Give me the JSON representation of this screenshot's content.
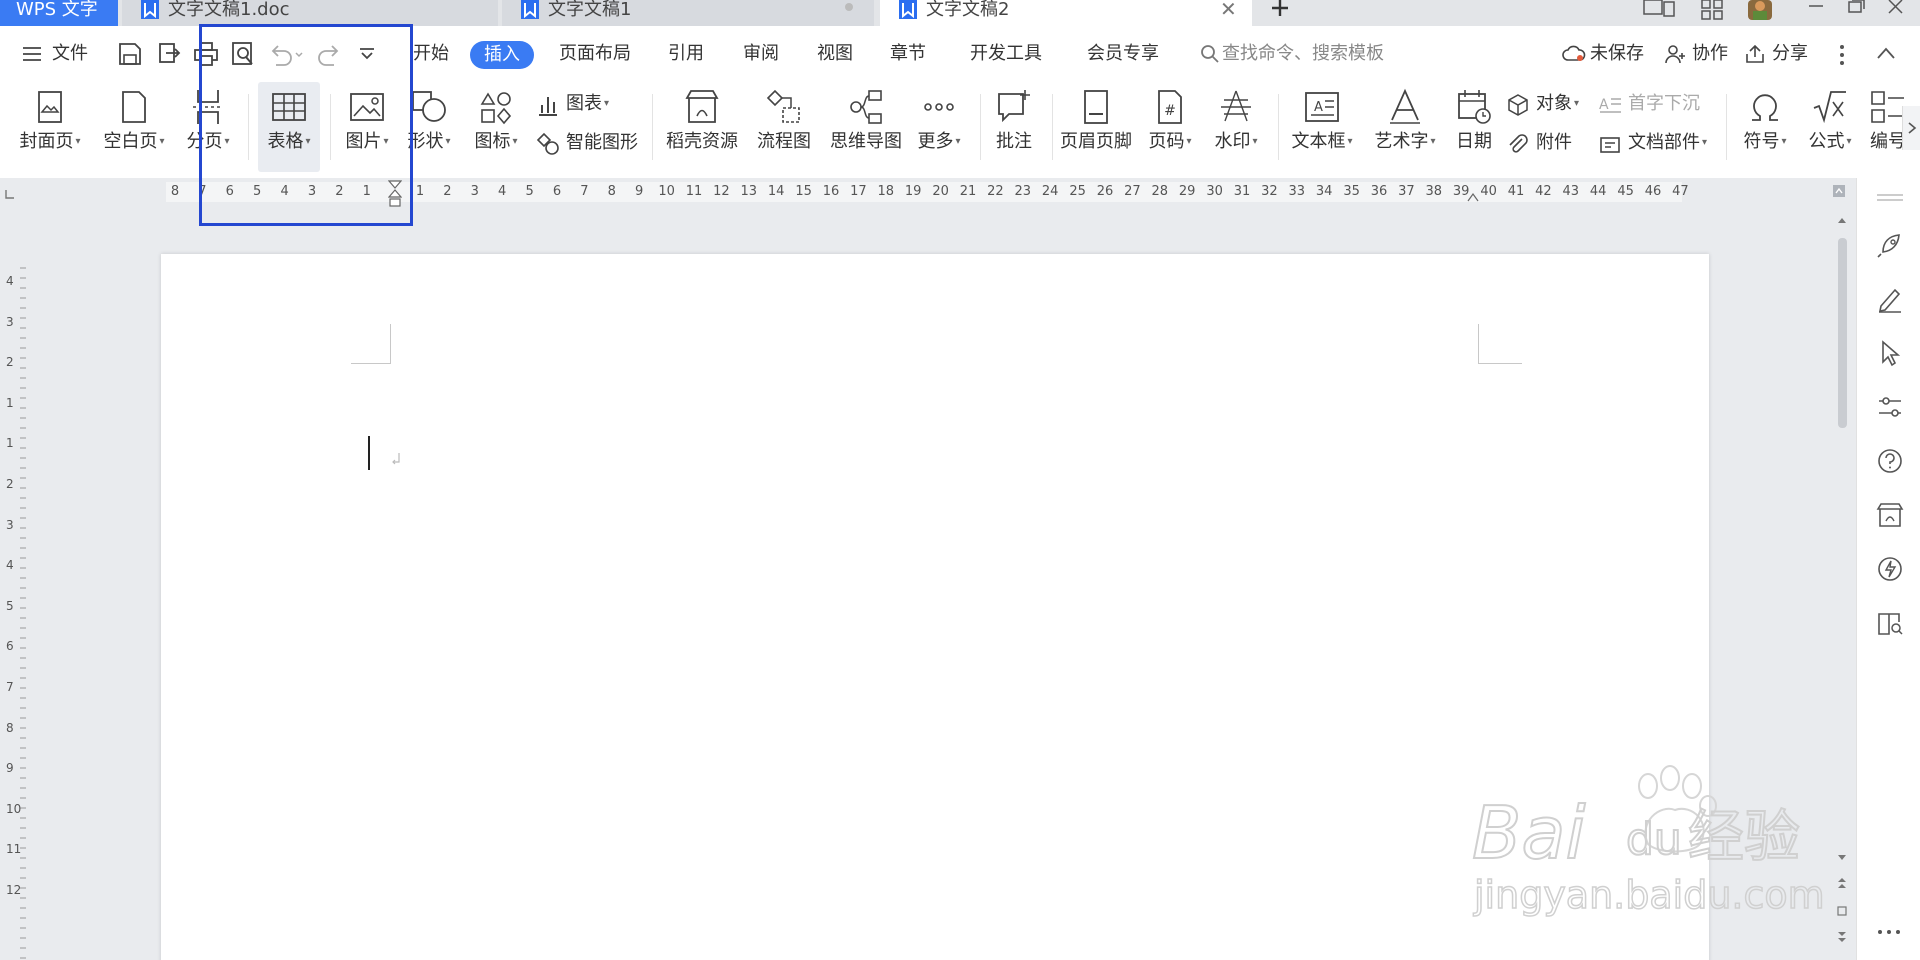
{
  "window": {
    "app_tab": "WPS 文字",
    "tabs": [
      {
        "name": "文字文稿1.doc",
        "active": false
      },
      {
        "name": "文字文稿1",
        "active": false
      },
      {
        "name": "文字文稿2",
        "active": true
      }
    ]
  },
  "menu": {
    "file": "文件",
    "tabs": [
      "开始",
      "插入",
      "页面布局",
      "引用",
      "审阅",
      "视图",
      "章节",
      "开发工具",
      "会员专享"
    ],
    "active_tab": "插入",
    "search_placeholder": "查找命令、搜索模板",
    "unsaved": "未保存",
    "collaborate": "协作",
    "share": "分享"
  },
  "ribbon": {
    "cover": "封面页",
    "blank": "空白页",
    "pagebreak": "分页",
    "table": "表格",
    "picture": "图片",
    "shape": "形状",
    "icons": "图标",
    "chart": "图表",
    "smart_graphic": "智能图形",
    "docer": "稻壳资源",
    "flowchart": "流程图",
    "mindmap": "思维导图",
    "more": "更多",
    "comment": "批注",
    "header_footer": "页眉页脚",
    "page_number": "页码",
    "watermark": "水印",
    "textbox": "文本框",
    "wordart": "艺术字",
    "date": "日期",
    "object": "对象",
    "dropcap": "首字下沉",
    "attachment": "附件",
    "doc_parts": "文档部件",
    "symbol": "符号",
    "formula": "公式",
    "edit": "编号"
  },
  "ruler": {
    "left_numbers": [
      "8",
      "7",
      "6",
      "5",
      "4",
      "3",
      "2",
      "1"
    ],
    "right_numbers": [
      "1",
      "2",
      "3",
      "4",
      "5",
      "6",
      "7",
      "8",
      "9",
      "10",
      "11",
      "12",
      "13",
      "14",
      "15",
      "16",
      "17",
      "18",
      "19",
      "20",
      "21",
      "22",
      "23",
      "24",
      "25",
      "26",
      "27",
      "28",
      "29",
      "30",
      "31",
      "32",
      "33",
      "34",
      "35",
      "36",
      "37",
      "38",
      "39",
      "40",
      "41",
      "42",
      "43",
      "44",
      "45",
      "46",
      "47"
    ],
    "vertical_numbers": [
      "4",
      "3",
      "2",
      "1",
      "1",
      "2",
      "3",
      "4",
      "5",
      "6",
      "7",
      "8",
      "9",
      "10",
      "11",
      "12"
    ]
  },
  "watermark": {
    "brand": "Baidu经验",
    "url": "jingyan.baidu.com"
  },
  "colors": {
    "accent": "#3a7bf3",
    "highlight_box": "#2447d0"
  }
}
